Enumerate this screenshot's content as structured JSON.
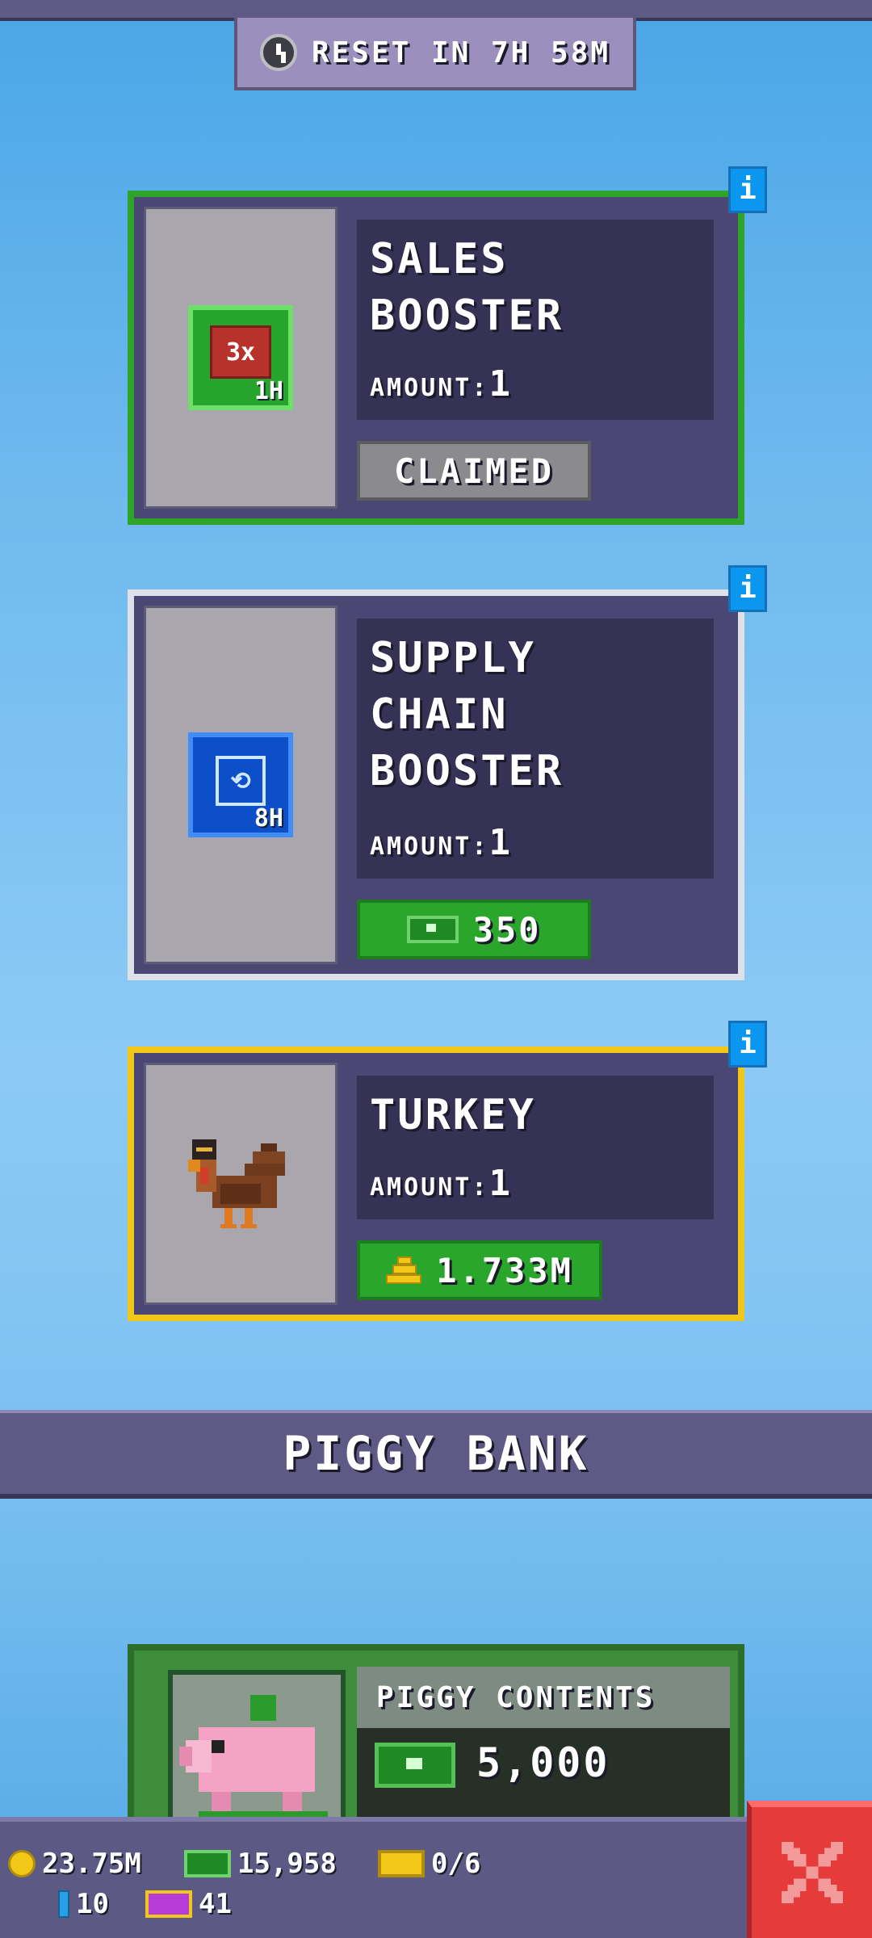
{
  "header": {
    "reset_text": "RESET IN 7H 58M"
  },
  "offers": [
    {
      "title_line1": "SALES",
      "title_line2": "BOOSTER",
      "amount_label": "AMOUNT:",
      "amount_value": "1",
      "icon_label": "3x",
      "icon_duration": "1H",
      "button_label": "CLAIMED",
      "border_color": "#2ea52a"
    },
    {
      "title_line1": "SUPPLY",
      "title_line2": "CHAIN",
      "title_line3": "BOOSTER",
      "amount_label": "AMOUNT:",
      "amount_value": "1",
      "icon_duration": "8H",
      "price": "350",
      "border_color": "#dfe1e8"
    },
    {
      "title_line1": "TURKEY",
      "amount_label": "AMOUNT:",
      "amount_value": "1",
      "price": "1.733M",
      "border_color": "#f2c818"
    }
  ],
  "info_label": "i",
  "piggy_bank": {
    "banner_title": "PIGGY BANK",
    "contents_label": "PIGGY CONTENTS",
    "contents_value": "5,000"
  },
  "resources": {
    "coins": "23.75M",
    "cash": "15,958",
    "tickets": "0/6",
    "gems": "10",
    "vouchers": "41"
  }
}
